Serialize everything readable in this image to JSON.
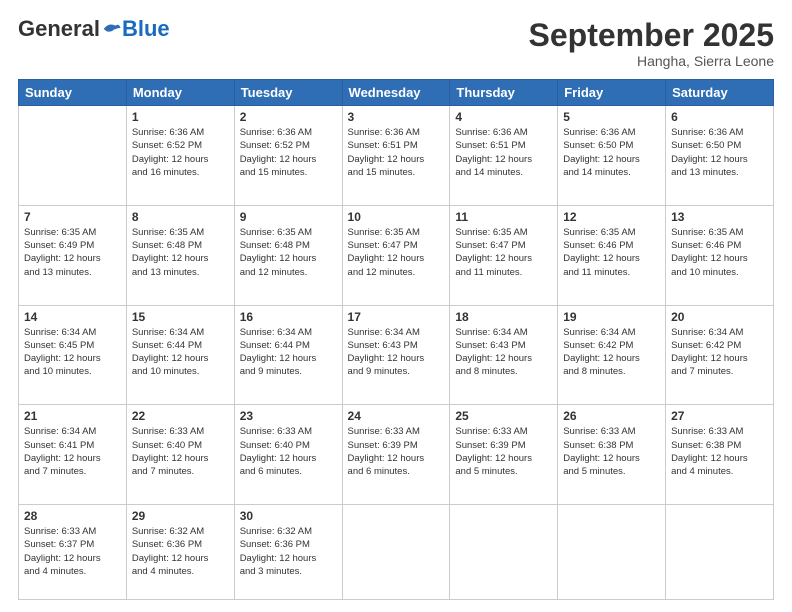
{
  "header": {
    "logo": {
      "general": "General",
      "blue": "Blue"
    },
    "title": "September 2025",
    "location": "Hangha, Sierra Leone"
  },
  "weekdays": [
    "Sunday",
    "Monday",
    "Tuesday",
    "Wednesday",
    "Thursday",
    "Friday",
    "Saturday"
  ],
  "weeks": [
    [
      {
        "day": "",
        "info": ""
      },
      {
        "day": "1",
        "info": "Sunrise: 6:36 AM\nSunset: 6:52 PM\nDaylight: 12 hours\nand 16 minutes."
      },
      {
        "day": "2",
        "info": "Sunrise: 6:36 AM\nSunset: 6:52 PM\nDaylight: 12 hours\nand 15 minutes."
      },
      {
        "day": "3",
        "info": "Sunrise: 6:36 AM\nSunset: 6:51 PM\nDaylight: 12 hours\nand 15 minutes."
      },
      {
        "day": "4",
        "info": "Sunrise: 6:36 AM\nSunset: 6:51 PM\nDaylight: 12 hours\nand 14 minutes."
      },
      {
        "day": "5",
        "info": "Sunrise: 6:36 AM\nSunset: 6:50 PM\nDaylight: 12 hours\nand 14 minutes."
      },
      {
        "day": "6",
        "info": "Sunrise: 6:36 AM\nSunset: 6:50 PM\nDaylight: 12 hours\nand 13 minutes."
      }
    ],
    [
      {
        "day": "7",
        "info": "Sunrise: 6:35 AM\nSunset: 6:49 PM\nDaylight: 12 hours\nand 13 minutes."
      },
      {
        "day": "8",
        "info": "Sunrise: 6:35 AM\nSunset: 6:48 PM\nDaylight: 12 hours\nand 13 minutes."
      },
      {
        "day": "9",
        "info": "Sunrise: 6:35 AM\nSunset: 6:48 PM\nDaylight: 12 hours\nand 12 minutes."
      },
      {
        "day": "10",
        "info": "Sunrise: 6:35 AM\nSunset: 6:47 PM\nDaylight: 12 hours\nand 12 minutes."
      },
      {
        "day": "11",
        "info": "Sunrise: 6:35 AM\nSunset: 6:47 PM\nDaylight: 12 hours\nand 11 minutes."
      },
      {
        "day": "12",
        "info": "Sunrise: 6:35 AM\nSunset: 6:46 PM\nDaylight: 12 hours\nand 11 minutes."
      },
      {
        "day": "13",
        "info": "Sunrise: 6:35 AM\nSunset: 6:46 PM\nDaylight: 12 hours\nand 10 minutes."
      }
    ],
    [
      {
        "day": "14",
        "info": "Sunrise: 6:34 AM\nSunset: 6:45 PM\nDaylight: 12 hours\nand 10 minutes."
      },
      {
        "day": "15",
        "info": "Sunrise: 6:34 AM\nSunset: 6:44 PM\nDaylight: 12 hours\nand 10 minutes."
      },
      {
        "day": "16",
        "info": "Sunrise: 6:34 AM\nSunset: 6:44 PM\nDaylight: 12 hours\nand 9 minutes."
      },
      {
        "day": "17",
        "info": "Sunrise: 6:34 AM\nSunset: 6:43 PM\nDaylight: 12 hours\nand 9 minutes."
      },
      {
        "day": "18",
        "info": "Sunrise: 6:34 AM\nSunset: 6:43 PM\nDaylight: 12 hours\nand 8 minutes."
      },
      {
        "day": "19",
        "info": "Sunrise: 6:34 AM\nSunset: 6:42 PM\nDaylight: 12 hours\nand 8 minutes."
      },
      {
        "day": "20",
        "info": "Sunrise: 6:34 AM\nSunset: 6:42 PM\nDaylight: 12 hours\nand 7 minutes."
      }
    ],
    [
      {
        "day": "21",
        "info": "Sunrise: 6:34 AM\nSunset: 6:41 PM\nDaylight: 12 hours\nand 7 minutes."
      },
      {
        "day": "22",
        "info": "Sunrise: 6:33 AM\nSunset: 6:40 PM\nDaylight: 12 hours\nand 7 minutes."
      },
      {
        "day": "23",
        "info": "Sunrise: 6:33 AM\nSunset: 6:40 PM\nDaylight: 12 hours\nand 6 minutes."
      },
      {
        "day": "24",
        "info": "Sunrise: 6:33 AM\nSunset: 6:39 PM\nDaylight: 12 hours\nand 6 minutes."
      },
      {
        "day": "25",
        "info": "Sunrise: 6:33 AM\nSunset: 6:39 PM\nDaylight: 12 hours\nand 5 minutes."
      },
      {
        "day": "26",
        "info": "Sunrise: 6:33 AM\nSunset: 6:38 PM\nDaylight: 12 hours\nand 5 minutes."
      },
      {
        "day": "27",
        "info": "Sunrise: 6:33 AM\nSunset: 6:38 PM\nDaylight: 12 hours\nand 4 minutes."
      }
    ],
    [
      {
        "day": "28",
        "info": "Sunrise: 6:33 AM\nSunset: 6:37 PM\nDaylight: 12 hours\nand 4 minutes."
      },
      {
        "day": "29",
        "info": "Sunrise: 6:32 AM\nSunset: 6:36 PM\nDaylight: 12 hours\nand 4 minutes."
      },
      {
        "day": "30",
        "info": "Sunrise: 6:32 AM\nSunset: 6:36 PM\nDaylight: 12 hours\nand 3 minutes."
      },
      {
        "day": "",
        "info": ""
      },
      {
        "day": "",
        "info": ""
      },
      {
        "day": "",
        "info": ""
      },
      {
        "day": "",
        "info": ""
      }
    ]
  ]
}
